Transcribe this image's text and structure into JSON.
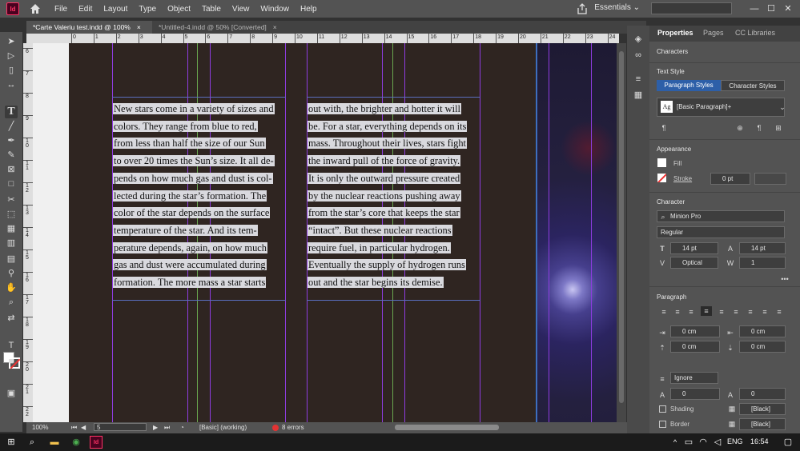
{
  "app": {
    "logo": "Id",
    "menu": [
      "File",
      "Edit",
      "Layout",
      "Type",
      "Object",
      "Table",
      "View",
      "Window",
      "Help"
    ],
    "workspace": "Essentials",
    "window_controls": [
      "—",
      "☐",
      "✕"
    ]
  },
  "tabs": [
    {
      "label": "*Carte Valeriu test.indd @ 100%",
      "close": "×"
    },
    {
      "label": "*Untitled-4.indd @ 50% [Converted]",
      "close": "×"
    }
  ],
  "ruler_top": [
    "0",
    "1",
    "2",
    "3",
    "4",
    "5",
    "6",
    "7",
    "8",
    "9",
    "10",
    "11",
    "12",
    "13",
    "14",
    "15",
    "16",
    "17",
    "18",
    "19",
    "20",
    "21",
    "22",
    "23",
    "24"
  ],
  "ruler_left": [
    "6",
    "7",
    "8",
    "9",
    "10",
    "11",
    "12",
    "13",
    "14",
    "15",
    "16",
    "17",
    "18",
    "19",
    "20",
    "21",
    "22"
  ],
  "text_left": [
    "New stars come in a variety of sizes and",
    "colors. They range from blue to red,",
    "from less than half the size of our Sun",
    "to over 20 times the Sun’s size. It all de-",
    "pends on how much gas and dust is col-",
    "lected during the star’s formation. The",
    "color of the star depends on the surface",
    "temperature of the star. And its tem-",
    "perature depends, again, on how much",
    "gas and dust were accumulated during",
    "formation. The more mass a star starts"
  ],
  "text_right": [
    "out with, the brighter and hotter it will",
    "be. For a star, everything depends on its",
    "mass. Throughout their lives, stars fight",
    "the inward pull of the force of gravity.",
    "It is only the outward pressure created",
    "by the nuclear reactions pushing away",
    "from the star’s core that keeps the star",
    "“intact”. But these nuclear reactions",
    "require fuel, in particular hydrogen.",
    "Eventually the supply of hydrogen runs",
    "out and the star begins its demise."
  ],
  "status": {
    "zoom": "100%",
    "page": "5",
    "style": "[Basic] (working)",
    "errors": "8 errors"
  },
  "panel": {
    "tabs": [
      "Properties",
      "Pages",
      "CC Libraries"
    ],
    "characters": "Characters",
    "text_style": "Text Style",
    "style_tabs": [
      "Paragraph Styles",
      "Character Styles"
    ],
    "para_style": "[Basic Paragraph]+",
    "para_style_icon": "Ag",
    "appearance": "Appearance",
    "fill": "Fill",
    "stroke": "Stroke",
    "stroke_weight": "0 pt",
    "character": "Character",
    "font": "Minion Pro",
    "font_style": "Regular",
    "font_size": "14 pt",
    "leading": "14 pt",
    "kerning": "Optical",
    "tracking": "1",
    "paragraph": "Paragraph",
    "left_indent": "0 cm",
    "right_indent": "0 cm",
    "space_before": "0 cm",
    "space_after": "0 cm",
    "align_grid": "Ignore",
    "drop_lines": "0",
    "drop_chars": "0",
    "shading": "Shading",
    "border": "Border",
    "swatch": "[Black]"
  },
  "taskbar": {
    "lang": "ENG",
    "time": "16:54"
  },
  "colors": {
    "page_bg": "#2f2521",
    "text_highlight": "#d9d9de",
    "guide_purple": "#8e3ce0",
    "guide_green": "#6aa84f",
    "accent_blue": "#2d5fa8",
    "error_red": "#e33333"
  }
}
